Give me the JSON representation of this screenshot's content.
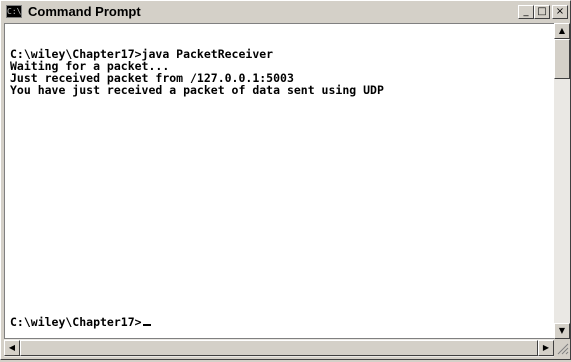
{
  "window": {
    "title": "Command Prompt",
    "icon": "cmd-icon",
    "icon_text": "C:\\",
    "controls": {
      "minimize": "_",
      "maximize": "□",
      "close": "×"
    }
  },
  "console": {
    "lines": [
      "C:\\wiley\\Chapter17>java PacketReceiver",
      "Waiting for a packet...",
      "Just received packet from /127.0.0.1:5003",
      "You have just received a packet of data sent using UDP"
    ],
    "prompt": "C:\\wiley\\Chapter17>"
  },
  "scrollbars": {
    "up": "▲",
    "down": "▼",
    "left": "◀",
    "right": "▶"
  }
}
